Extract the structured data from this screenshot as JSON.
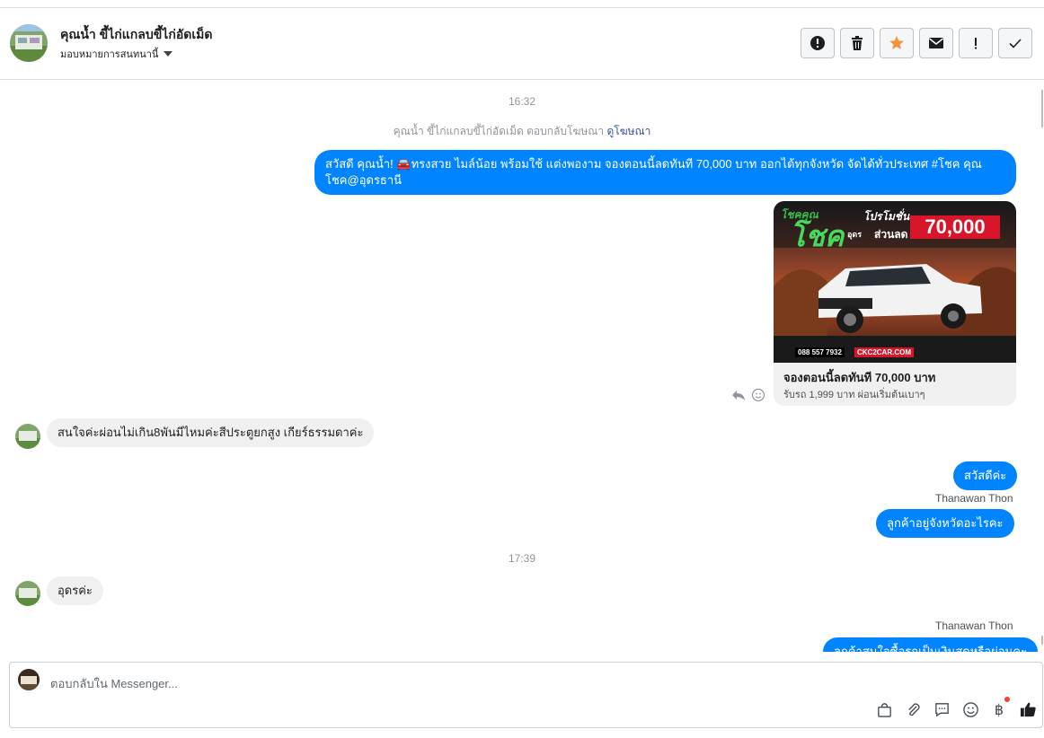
{
  "header": {
    "name": "คุณน้ำ ขี้ไก่แกลบขี้ไก่อัดเม็ด",
    "assign": "มอบหมายการสนทนานี้",
    "actions": [
      {
        "name": "report-spam",
        "icon": "exclamation-circle-icon"
      },
      {
        "name": "delete",
        "icon": "trash-icon"
      },
      {
        "name": "star",
        "icon": "star-icon",
        "color": "#f7923b"
      },
      {
        "name": "mark-unread",
        "icon": "envelope-icon"
      },
      {
        "name": "follow-up",
        "icon": "exclamation-icon"
      },
      {
        "name": "mark-done",
        "icon": "check-icon"
      }
    ]
  },
  "conversation": {
    "time1": "16:32",
    "system_note": "คุณน้ำ ขี้ไก่แกลบขี้ไก่อัดเม็ด ตอบกลับโฆษณา",
    "system_link": "ดูโฆษณา",
    "msg1": "สวัสดี คุณน้ำ! 🚘ทรงสวย ไมล์น้อย พร้อมใช้ แต่งพองาม จองตอนนี้ลดทันที 70,000 บาท ออกได้ทุกจังหวัด จัดได้ทั่วประเทศ #โชค คุณโชค@อุดรธานี",
    "ad": {
      "title": "จองตอนนี้ลดทันที 70,000 บาท",
      "description": "รับรถ 1,999 บาท ผ่อนเริ่มต้นเบาๆ",
      "banner_brand": "โชคคุณ",
      "banner_brand2": "โชค",
      "banner_sub": "อุดร",
      "banner_promo": "โปรโมชั่น",
      "banner_promo2": "ส่วนลด",
      "banner_amount": "70,000",
      "banner_phone": "088 557 7932",
      "banner_site": "CKC2CAR.COM"
    },
    "msg2": "สนใจค่ะผ่อนไม่เกิน8พันมีไหมค่ะสีประตูยกสูง เกียร์ธรรมดาค่ะ",
    "msg3": "สวัสดีค่ะ",
    "sender1": "Thanawan Thon",
    "msg4": "ลูกค้าอยู่จังหวัดอะไรคะ",
    "time2": "17:39",
    "msg5": "อุดรค่ะ",
    "sender2": "Thanawan Thon",
    "msg6": "ลูกค้าสนใจซื้อรถเป็นเงินสดหรือผ่อนคะ"
  },
  "composer": {
    "placeholder": "ตอบกลับใน Messenger...",
    "tools": [
      "shopping-bag-icon",
      "paperclip-icon",
      "saved-reply-icon",
      "emoji-icon",
      "baht-icon",
      "like-icon"
    ],
    "baht_symbol": "฿",
    "accent": "#0084ff"
  }
}
